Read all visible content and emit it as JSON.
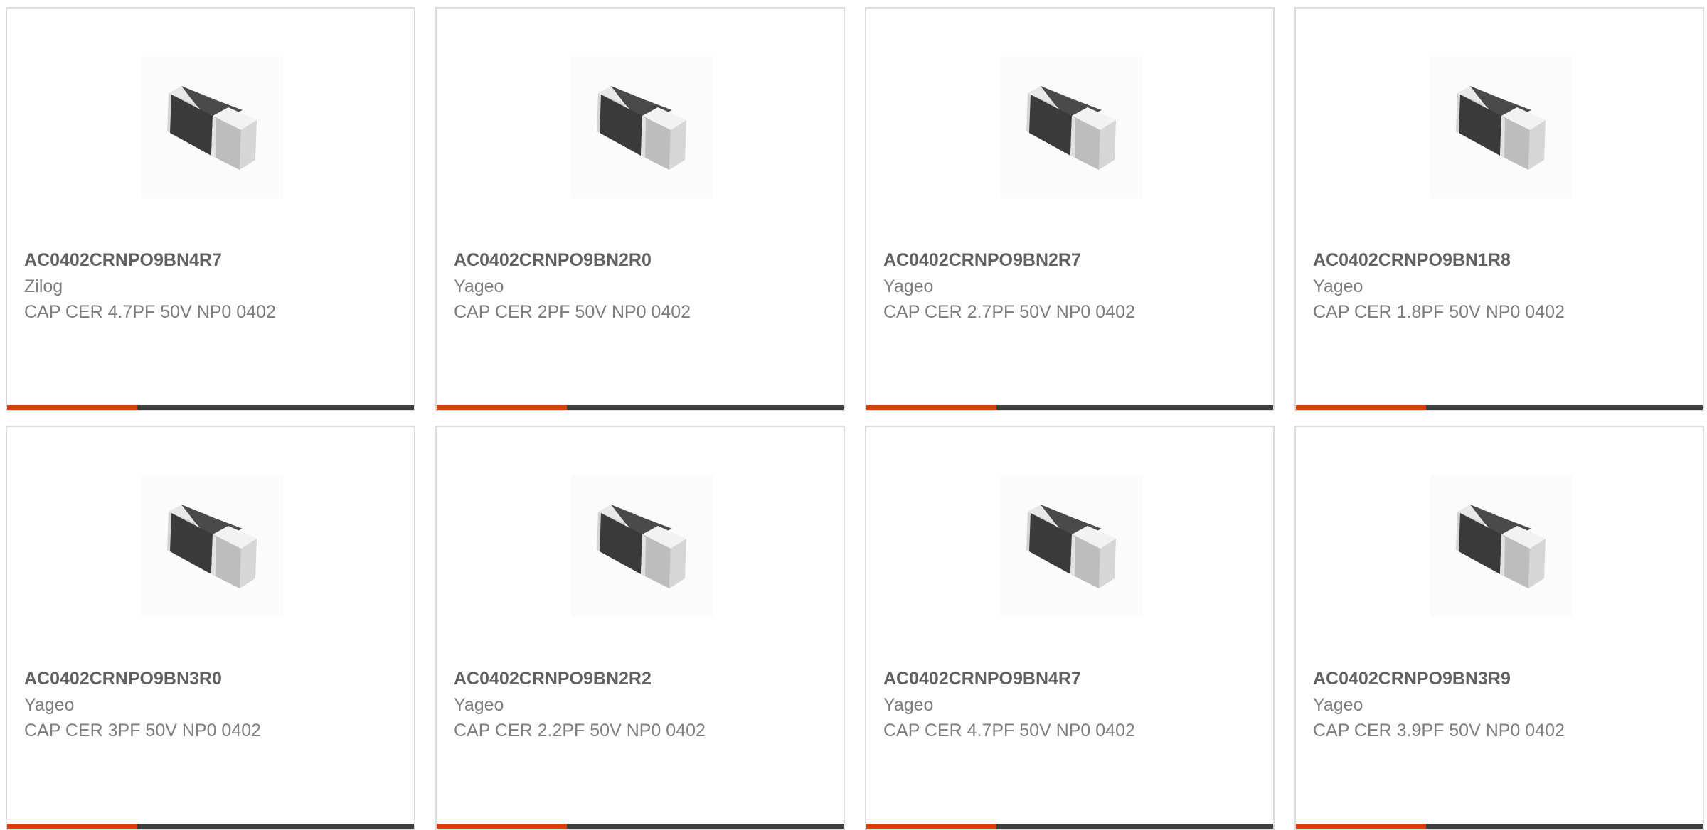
{
  "colors": {
    "accent": "#d8400c",
    "bar_track": "#3d3d3d",
    "card_border": "#dcdcdc",
    "part_number_text": "#616161",
    "secondary_text": "#7d7d7d"
  },
  "image_icon": "smd-capacitor-chip",
  "products": [
    {
      "part_number": "AC0402CRNPO9BN4R7",
      "manufacturer": "Zilog",
      "description": "CAP CER 4.7PF 50V NP0 0402",
      "bar_fill": 0.32
    },
    {
      "part_number": "AC0402CRNPO9BN2R0",
      "manufacturer": "Yageo",
      "description": "CAP CER 2PF 50V NP0 0402",
      "bar_fill": 0.32
    },
    {
      "part_number": "AC0402CRNPO9BN2R7",
      "manufacturer": "Yageo",
      "description": "CAP CER 2.7PF 50V NP0 0402",
      "bar_fill": 0.32
    },
    {
      "part_number": "AC0402CRNPO9BN1R8",
      "manufacturer": "Yageo",
      "description": "CAP CER 1.8PF 50V NP0 0402",
      "bar_fill": 0.32
    },
    {
      "part_number": "AC0402CRNPO9BN3R0",
      "manufacturer": "Yageo",
      "description": "CAP CER 3PF 50V NP0 0402",
      "bar_fill": 0.32
    },
    {
      "part_number": "AC0402CRNPO9BN2R2",
      "manufacturer": "Yageo",
      "description": "CAP CER 2.2PF 50V NP0 0402",
      "bar_fill": 0.32
    },
    {
      "part_number": "AC0402CRNPO9BN4R7",
      "manufacturer": "Yageo",
      "description": "CAP CER 4.7PF 50V NP0 0402",
      "bar_fill": 0.32
    },
    {
      "part_number": "AC0402CRNPO9BN3R9",
      "manufacturer": "Yageo",
      "description": "CAP CER 3.9PF 50V NP0 0402",
      "bar_fill": 0.32
    }
  ]
}
